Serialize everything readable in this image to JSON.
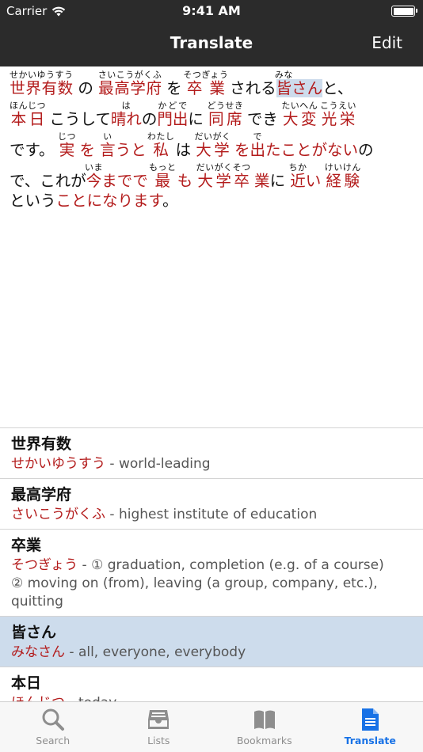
{
  "status_bar": {
    "carrier": "Carrier",
    "time": "9:41 AM"
  },
  "nav": {
    "title": "Translate",
    "edit_label": "Edit"
  },
  "text_lines": [
    [
      {
        "t": "世界有数",
        "r": "せかいゆうすう",
        "w": true
      },
      {
        "t": " の ",
        "r": ""
      },
      {
        "t": "最高学府",
        "r": "さいこうがくふ",
        "w": true
      },
      {
        "t": " を ",
        "r": ""
      },
      {
        "t": "卒業",
        "r": "そつぎょう",
        "w": true
      },
      {
        "t": " される",
        "r": ""
      },
      {
        "t": "皆",
        "r": "みな",
        "w": true,
        "hl": true
      },
      {
        "t": "さん",
        "r": "",
        "w": true,
        "hl": true
      },
      {
        "t": "と、",
        "r": ""
      }
    ],
    [
      {
        "t": "本日",
        "r": "ほんじつ",
        "w": true
      },
      {
        "t": " こうして",
        "r": ""
      },
      {
        "t": "晴れ",
        "r": "は",
        "w": true
      },
      {
        "t": "の",
        "r": ""
      },
      {
        "t": "門出",
        "r": "かどで",
        "w": true
      },
      {
        "t": "に ",
        "r": ""
      },
      {
        "t": "同席",
        "r": "どうせき",
        "w": true
      },
      {
        "t": " でき ",
        "r": ""
      },
      {
        "t": "大変",
        "r": "たいへん",
        "w": true
      },
      {
        "t": "  ",
        "r": ""
      },
      {
        "t": "光栄",
        "r": "こうえい",
        "w": true
      }
    ],
    [
      {
        "t": "です。 ",
        "r": ""
      },
      {
        "t": "実",
        "r": "じつ",
        "w": true
      },
      {
        "t": " を ",
        "r": "",
        "w": true
      },
      {
        "t": "言",
        "r": "い",
        "w": true
      },
      {
        "t": "うと ",
        "r": "",
        "w": true
      },
      {
        "t": "私",
        "r": "わたし",
        "w": true
      },
      {
        "t": " は ",
        "r": ""
      },
      {
        "t": "大学",
        "r": "だいがく",
        "w": true
      },
      {
        "t": " を",
        "r": "",
        "w": true
      },
      {
        "t": "出",
        "r": "で",
        "w": true
      },
      {
        "t": "たことがない",
        "r": "",
        "w": true
      },
      {
        "t": "の",
        "r": ""
      }
    ],
    [
      {
        "t": "で、これが",
        "r": ""
      },
      {
        "t": "今",
        "r": "いま",
        "w": true
      },
      {
        "t": "までで ",
        "r": "",
        "w": true
      },
      {
        "t": "最",
        "r": "もっと",
        "w": true
      },
      {
        "t": " も ",
        "r": "",
        "w": true
      },
      {
        "t": "大学卒",
        "r": "だいがくそつ",
        "w": true
      },
      {
        "t": " 業",
        "r": "",
        "w": true
      },
      {
        "t": "に ",
        "r": ""
      },
      {
        "t": "近",
        "r": "ちか",
        "w": true
      },
      {
        "t": "い ",
        "r": "",
        "w": true
      },
      {
        "t": "経験",
        "r": "けいけん",
        "w": true
      }
    ],
    [
      {
        "t": "という",
        "r": ""
      },
      {
        "t": "ことになります",
        "r": "",
        "w": true
      },
      {
        "t": "。",
        "r": ""
      }
    ]
  ],
  "definitions": [
    {
      "word": "世界有数",
      "reading": "せかいゆうすう",
      "meaning": " - world-leading",
      "selected": false
    },
    {
      "word": "最高学府",
      "reading": "さいこうがくふ",
      "meaning": " - highest institute of education",
      "selected": false
    },
    {
      "word": "卒業",
      "reading": "そつぎょう",
      "meaning": " - ① graduation, completion (e.g. of a course)",
      "extra": [
        "② moving on (from), leaving (a group, company, etc.),",
        "quitting"
      ],
      "selected": false
    },
    {
      "word": "皆さん",
      "reading": "みなさん",
      "meaning": " - all, everyone, everybody",
      "selected": true
    },
    {
      "word": "本日",
      "reading": "ほんじつ",
      "meaning": " - today",
      "selected": false
    }
  ],
  "tabs": [
    {
      "label": "Search",
      "icon": "search-icon",
      "active": false
    },
    {
      "label": "Lists",
      "icon": "tray-icon",
      "active": false
    },
    {
      "label": "Bookmarks",
      "icon": "book-icon",
      "active": false
    },
    {
      "label": "Translate",
      "icon": "document-icon",
      "active": true
    }
  ],
  "colors": {
    "accent": "#1872e6",
    "word": "#b31b1b",
    "highlight": "#cddcec",
    "topbar": "#2b2b2b"
  }
}
